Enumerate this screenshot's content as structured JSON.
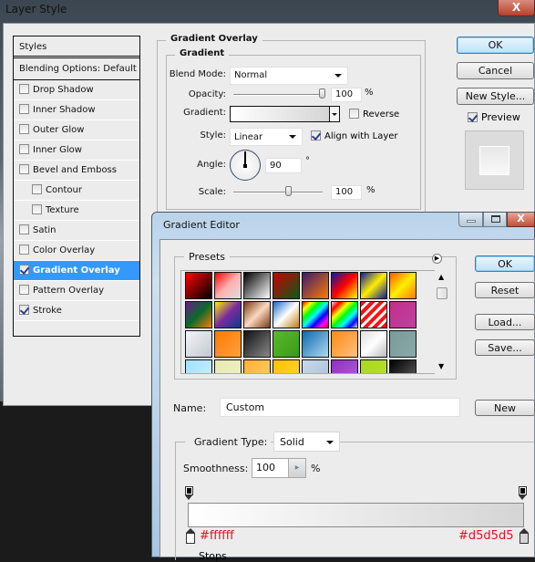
{
  "layer_style": {
    "title": "Layer Style",
    "close_label": "X",
    "styles_header": "Styles",
    "blending_options": "Blending Options: Default",
    "styles": [
      {
        "label": "Drop Shadow",
        "checked": false,
        "indent": false
      },
      {
        "label": "Inner Shadow",
        "checked": false,
        "indent": false
      },
      {
        "label": "Outer Glow",
        "checked": false,
        "indent": false
      },
      {
        "label": "Inner Glow",
        "checked": false,
        "indent": false
      },
      {
        "label": "Bevel and Emboss",
        "checked": false,
        "indent": false
      },
      {
        "label": "Contour",
        "checked": false,
        "indent": true
      },
      {
        "label": "Texture",
        "checked": false,
        "indent": true
      },
      {
        "label": "Satin",
        "checked": false,
        "indent": false
      },
      {
        "label": "Color Overlay",
        "checked": false,
        "indent": false
      },
      {
        "label": "Gradient Overlay",
        "checked": true,
        "indent": false,
        "selected": true
      },
      {
        "label": "Pattern Overlay",
        "checked": false,
        "indent": false
      },
      {
        "label": "Stroke",
        "checked": true,
        "indent": false
      }
    ],
    "section_title": "Gradient Overlay",
    "subsection_title": "Gradient",
    "blend_mode_label": "Blend Mode:",
    "blend_mode_value": "Normal",
    "opacity_label": "Opacity:",
    "opacity_value": "100",
    "opacity_unit": "%",
    "opacity_fraction": 1.0,
    "gradient_label": "Gradient:",
    "reverse_label": "Reverse",
    "reverse_checked": false,
    "style_label": "Style:",
    "style_value": "Linear",
    "align_label": "Align with Layer",
    "align_checked": true,
    "angle_label": "Angle:",
    "angle_value": "90",
    "angle_unit": "°",
    "scale_label": "Scale:",
    "scale_value": "100",
    "scale_unit": "%",
    "buttons": {
      "ok": "OK",
      "cancel": "Cancel",
      "new_style": "New Style..."
    },
    "preview_label": "Preview",
    "preview_checked": true
  },
  "gradient_editor": {
    "title": "Gradient Editor",
    "presets_label": "Presets",
    "buttons": {
      "ok": "OK",
      "reset": "Reset",
      "load": "Load...",
      "save": "Save...",
      "new": "New"
    },
    "name_label": "Name:",
    "name_value": "Custom",
    "gradient_type_label": "Gradient Type:",
    "gradient_type_value": "Solid",
    "smoothness_label": "Smoothness:",
    "smoothness_value": "100",
    "smoothness_unit": "%",
    "stops_label": "Stops",
    "start_color": "#ffffff",
    "end_color": "#d5d5d5",
    "start_color_label": "#ffffff",
    "end_color_label": "#d5d5d5",
    "presets": [
      "linear-gradient(135deg,#ff0000,#000)",
      "linear-gradient(135deg,#ff0000,#ffb0b0 50%,#ddd)",
      "linear-gradient(135deg,#000,#fff)",
      "linear-gradient(135deg,#cc0000,#0a5a1a)",
      "linear-gradient(135deg,#3a1a70,#ff7a00)",
      "linear-gradient(135deg,#0a1aa0,#ff0000 50%,#ffff00)",
      "linear-gradient(135deg,#0a1aa0,#ffee00 50%,#0a1aa0)",
      "linear-gradient(135deg,#ff5a00,#ffee00 50%,#ff7a00)",
      "linear-gradient(135deg,#6a1a8a,#0a6a2a 50%,#ff7a00)",
      "linear-gradient(135deg,#ffee00,#7a2aa0 50%,#0a3a8a)",
      "linear-gradient(135deg,#7a3a10,#fbd8c0 50%,#7a3a10)",
      "linear-gradient(135deg,#1a6ac8,#fff 50%,#c07a10)",
      "linear-gradient(135deg,#ff0000,#ffff00,#00ff00,#00ffff,#0000ff,#ff00ff,#ff0000)",
      "linear-gradient(135deg,#ddd,#ff0000,#ffff00,#00ff00,#00ffff,#0000ff,#ddd)",
      "repeating-linear-gradient(135deg,#ff1010 0 4px,#fff 4px 7px)",
      "linear-gradient(135deg,#c0308a,#c040a0)",
      "linear-gradient(135deg,#f4f6f8,#c0c8d0)",
      "linear-gradient(135deg,#ff7a00,#ffa040)",
      "linear-gradient(135deg,#111,#888)",
      "linear-gradient(135deg,#5aba2a,#3a9a1a)",
      "linear-gradient(135deg,#0a6ab0,#b0d8f0)",
      "linear-gradient(135deg,#ff8a10,#ffc080)",
      "linear-gradient(135deg,#ddd,#fff 50%,#bbb)",
      "linear-gradient(135deg,#7a9a9a,#8aa8a8)",
      "linear-gradient(135deg,#a0e0ff,#d0f0ff)",
      "linear-gradient(135deg,#e8eab0,#f0f0c8)",
      "linear-gradient(135deg,#ffb030,#ffd070)",
      "linear-gradient(135deg,#ffc000,#ffd840)",
      "linear-gradient(135deg,#c8d8e8,#a8c0d8)",
      "linear-gradient(135deg,#9030c0,#b060e0)",
      "linear-gradient(135deg,#a8d820,#b8e030)",
      "linear-gradient(135deg,#000,#666)"
    ]
  }
}
